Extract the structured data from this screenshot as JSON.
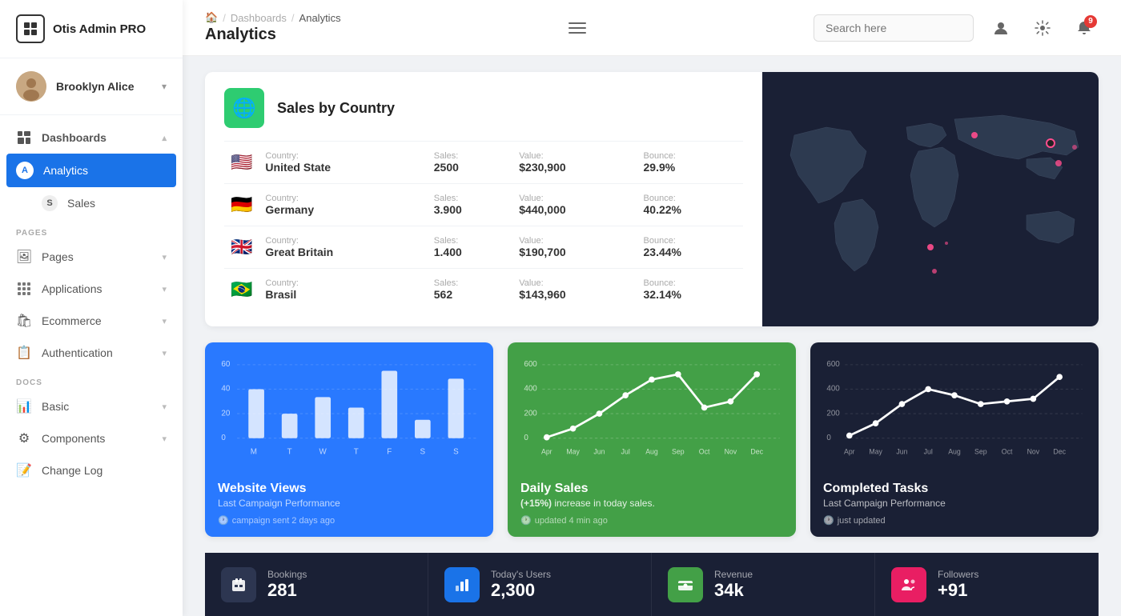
{
  "app": {
    "name": "Otis Admin PRO"
  },
  "user": {
    "name": "Brooklyn Alice"
  },
  "header": {
    "breadcrumb": {
      "home": "🏠",
      "dashboards": "Dashboards",
      "current": "Analytics"
    },
    "title": "Analytics",
    "search_placeholder": "Search here"
  },
  "sidebar": {
    "section_pages": "PAGES",
    "section_docs": "DOCS",
    "items": [
      {
        "id": "dashboards",
        "label": "Dashboards",
        "icon": "⊞",
        "active": false,
        "parent": true
      },
      {
        "id": "analytics",
        "label": "Analytics",
        "icon": "A",
        "active": true
      },
      {
        "id": "sales",
        "label": "Sales",
        "icon": "S",
        "active": false
      },
      {
        "id": "pages",
        "label": "Pages",
        "icon": "🖼",
        "active": false
      },
      {
        "id": "applications",
        "label": "Applications",
        "icon": "⊞",
        "active": false
      },
      {
        "id": "ecommerce",
        "label": "Ecommerce",
        "icon": "🛍",
        "active": false
      },
      {
        "id": "authentication",
        "label": "Authentication",
        "icon": "📋",
        "active": false
      },
      {
        "id": "basic",
        "label": "Basic",
        "icon": "📊",
        "active": false
      },
      {
        "id": "components",
        "label": "Components",
        "icon": "⚙",
        "active": false
      },
      {
        "id": "changelog",
        "label": "Change Log",
        "icon": "📝",
        "active": false
      }
    ]
  },
  "sales_by_country": {
    "title": "Sales by Country",
    "rows": [
      {
        "flag": "🇺🇸",
        "country_label": "Country:",
        "country": "United State",
        "sales_label": "Sales:",
        "sales": "2500",
        "value_label": "Value:",
        "value": "$230,900",
        "bounce_label": "Bounce:",
        "bounce": "29.9%"
      },
      {
        "flag": "🇩🇪",
        "country_label": "Country:",
        "country": "Germany",
        "sales_label": "Sales:",
        "sales": "3.900",
        "value_label": "Value:",
        "value": "$440,000",
        "bounce_label": "Bounce:",
        "bounce": "40.22%"
      },
      {
        "flag": "🇬🇧",
        "country_label": "Country:",
        "country": "Great Britain",
        "sales_label": "Sales:",
        "sales": "1.400",
        "value_label": "Value:",
        "value": "$190,700",
        "bounce_label": "Bounce:",
        "bounce": "23.44%"
      },
      {
        "flag": "🇧🇷",
        "country_label": "Country:",
        "country": "Brasil",
        "sales_label": "Sales:",
        "sales": "562",
        "value_label": "Value:",
        "value": "$143,960",
        "bounce_label": "Bounce:",
        "bounce": "32.14%"
      }
    ]
  },
  "charts": [
    {
      "id": "website-views",
      "title": "Website Views",
      "subtitle": "Last Campaign Performance",
      "meta": "campaign sent 2 days ago",
      "type": "bar",
      "color": "blue",
      "labels": [
        "M",
        "T",
        "W",
        "T",
        "F",
        "S",
        "S"
      ],
      "values": [
        40,
        20,
        35,
        25,
        55,
        15,
        45
      ],
      "y_max": 60,
      "y_labels": [
        "60",
        "40",
        "20",
        "0"
      ]
    },
    {
      "id": "daily-sales",
      "title": "Daily Sales",
      "subtitle": "(+15%) increase in today sales.",
      "meta": "updated 4 min ago",
      "type": "line",
      "color": "green",
      "labels": [
        "Apr",
        "May",
        "Jun",
        "Jul",
        "Aug",
        "Sep",
        "Oct",
        "Nov",
        "Dec"
      ],
      "values": [
        10,
        80,
        200,
        350,
        480,
        520,
        250,
        300,
        520
      ],
      "y_max": 600,
      "y_labels": [
        "600",
        "400",
        "200",
        "0"
      ]
    },
    {
      "id": "completed-tasks",
      "title": "Completed Tasks",
      "subtitle": "Last Campaign Performance",
      "meta": "just updated",
      "type": "line",
      "color": "dark",
      "labels": [
        "Apr",
        "May",
        "Jun",
        "Jul",
        "Aug",
        "Sep",
        "Oct",
        "Nov",
        "Dec"
      ],
      "values": [
        20,
        120,
        280,
        400,
        350,
        280,
        300,
        320,
        500
      ],
      "y_max": 600,
      "y_labels": [
        "600",
        "400",
        "200",
        "0"
      ]
    }
  ],
  "stats": [
    {
      "id": "bookings",
      "icon": "💼",
      "icon_style": "dark",
      "label": "Bookings",
      "value": "281"
    },
    {
      "id": "today-users",
      "icon": "📊",
      "icon_style": "blue",
      "label": "Today's Users",
      "value": "2,300"
    },
    {
      "id": "revenue",
      "icon": "🏪",
      "icon_style": "green",
      "label": "Revenue",
      "value": "34k"
    },
    {
      "id": "followers",
      "icon": "👤",
      "icon_style": "pink",
      "label": "Followers",
      "value": "+91"
    }
  ],
  "notification_count": "9"
}
